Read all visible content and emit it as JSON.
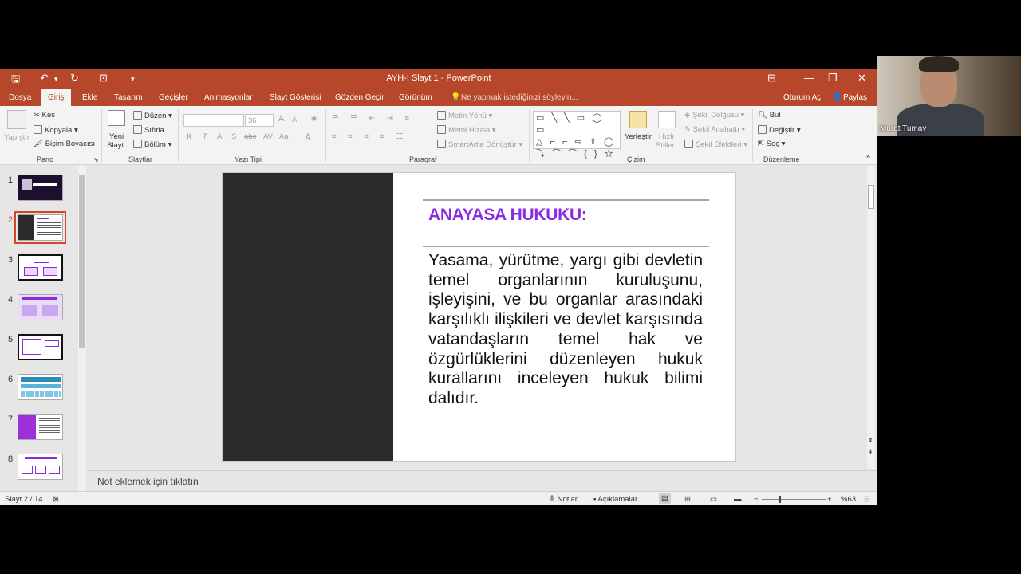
{
  "window": {
    "title": "AYH-I Slayt 1 - PowerPoint"
  },
  "tabs": {
    "file": "Dosya",
    "home": "Giriş",
    "insert": "Ekle",
    "design": "Tasarım",
    "transitions": "Geçişler",
    "animations": "Animasyonlar",
    "slideshow": "Slayt Gösterisi",
    "review": "Gözden Geçir",
    "view": "Görünüm",
    "tellme": "Ne yapmak istediğinizi söyleyin...",
    "signin": "Oturum Aç",
    "share": "Paylaş"
  },
  "ribbon": {
    "pano": {
      "paste": "Yapıştır",
      "cut": "Kes",
      "copy": "Kopyala",
      "format_painter": "Biçim Boyacısı",
      "label": "Pano"
    },
    "slides": {
      "new_slide_1": "Yeni",
      "new_slide_2": "Slayt",
      "layout": "Düzen",
      "reset": "Sıfırla",
      "section": "Bölüm",
      "label": "Slaytlar"
    },
    "font": {
      "size": "36",
      "bold": "K",
      "italic": "T",
      "underline": "A",
      "strike": "S",
      "shadow": "abc",
      "spacing": "AV",
      "case": "Aa",
      "color": "A",
      "grow": "A",
      "shrink": "A",
      "label": "Yazı Tipi"
    },
    "paragraph": {
      "text_direction": "Metin Yönü",
      "align_text": "Metni Hizala",
      "smartart": "SmartArt'a Dönüştür",
      "label": "Paragraf"
    },
    "drawing": {
      "shapes_row1": "▭ ╲ ╲ ▭ ◯ ▭",
      "shapes_row2": "△ ⌐ ⌐ ⇨ ⇧ ◯",
      "shapes_row3": "⤵ ⌒ ⌒ { } ☆",
      "arrange": "Yerleştir",
      "quick_styles_1": "Hızlı",
      "quick_styles_2": "Stiller",
      "fill": "Şekil Dolgusu",
      "outline": "Şekil Anahattı",
      "effects": "Şekil Efektleri",
      "label": "Çizim"
    },
    "editing": {
      "find": "Bul",
      "replace": "Değiştir",
      "select": "Seç",
      "label": "Düzenleme"
    }
  },
  "thumbnails": [
    "1",
    "2",
    "3",
    "4",
    "5",
    "6",
    "7",
    "8"
  ],
  "slide": {
    "heading": "ANAYASA HUKUKU:",
    "body": "Yasama, yürütme, yargı gibi devletin temel organlarının kuruluşunu, işleyişini, ve bu organlar arasındaki karşılıklı ilişkileri ve devlet karşısında vatandaşların temel hak ve özgürlüklerini düzenleyen hukuk kurallarını inceleyen hukuk bilimi dalıdır."
  },
  "notes": {
    "placeholder": "Not eklemek için tıklatın"
  },
  "status": {
    "slide_counter": "Slayt 2 / 14",
    "notes": "Notlar",
    "comments": "Açıklamalar",
    "zoom": "%63"
  },
  "webcam": {
    "name": "Murat Tumay"
  },
  "colors": {
    "accent": "#b7472a",
    "heading": "#8a2be2"
  }
}
